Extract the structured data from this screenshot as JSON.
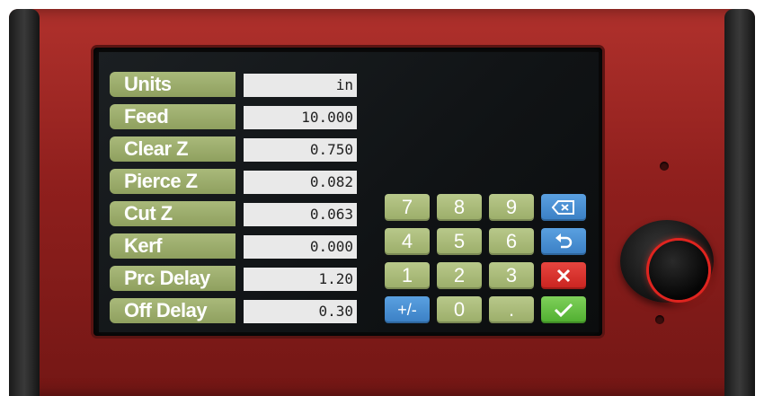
{
  "params": [
    {
      "label": "Units",
      "value": "in"
    },
    {
      "label": "Feed",
      "value": "10.000"
    },
    {
      "label": "Clear Z",
      "value": "0.750"
    },
    {
      "label": "Pierce Z",
      "value": "0.082"
    },
    {
      "label": "Cut Z",
      "value": "0.063"
    },
    {
      "label": "Kerf",
      "value": "0.000"
    },
    {
      "label": "Prc Delay",
      "value": "1.20"
    },
    {
      "label": "Off Delay",
      "value": "0.30"
    }
  ],
  "keypad": {
    "k7": "7",
    "k8": "8",
    "k9": "9",
    "k4": "4",
    "k5": "5",
    "k6": "6",
    "k1": "1",
    "k2": "2",
    "k3": "3",
    "sign": "+/-",
    "k0": "0",
    "dot": ".",
    "backspace_icon": "backspace-icon",
    "undo_icon": "undo-icon",
    "cancel_icon": "close-icon",
    "enter_icon": "checkmark-icon"
  },
  "colors": {
    "enclosure": "#9b2420",
    "label_bg": "#9aab68",
    "value_bg": "#e9e9e9",
    "key_num": "#a8b97a",
    "key_blue": "#4a8fd4",
    "key_red": "#d9322d",
    "key_green": "#62c040",
    "knob_ring": "#e0241f"
  }
}
